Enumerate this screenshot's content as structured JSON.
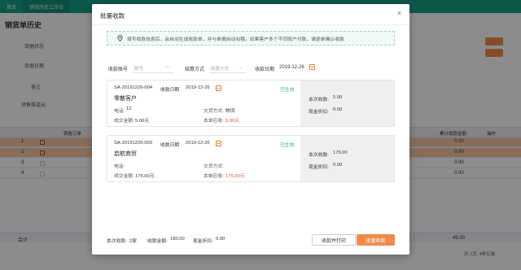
{
  "app": {
    "tabs": [
      "首页",
      "销货历史工作台"
    ],
    "page_title": "销货单历史",
    "form_labels": [
      "单据状态",
      "单据日期",
      "备注",
      "销售渠道出"
    ],
    "grid_headers": [
      "销售订单",
      "累计收款金额",
      "操作"
    ],
    "grid_rows": [
      {
        "no": "1",
        "amount": "0.00"
      },
      {
        "no": "2",
        "amount": "0.00"
      },
      {
        "no": "3",
        "amount": "0.00"
      },
      {
        "no": "4",
        "amount": "0.00"
      }
    ],
    "footer_label": "合计",
    "footer_total": "45.00",
    "pager_text": "共 1页, 4条记录"
  },
  "modal": {
    "title": "批量收款",
    "close": "×",
    "notice": "填写收款信息后，会自动生成收款单，并与单据自动勾稽。如果客户多个不同账户付款，请逐单确认收款",
    "filters": {
      "account_label": "收款账号",
      "account_placeholder": "账号",
      "method_label": "结算方式",
      "method_placeholder": "结算方式",
      "date_label": "收款日期",
      "date_value": "2019-12-26"
    },
    "cards": [
      {
        "order_no": "SA-20191226-004",
        "date_label": "收款日期",
        "date_value": "2019-12-26",
        "status": "已生效",
        "customer": "零散客户",
        "phone_label": "电话:",
        "phone": "12",
        "deal_amount_label": "成交金额:",
        "deal_amount": "5.00元",
        "trade_method_label": "交货方式:",
        "trade_method": "物流",
        "due_label": "本单应收:",
        "due": "5.00元",
        "this_receive_label": "本次收款:",
        "this_receive": "5.00",
        "discount_label": "现金折扣:",
        "discount": "0.00"
      },
      {
        "order_no": "SA-20191226-003",
        "date_label": "收款日期",
        "date_value": "2019-12-26",
        "status": "已生效",
        "customer": "启航商贸",
        "phone_label": "电话:",
        "phone": "",
        "deal_amount_label": "成交金额:",
        "deal_amount": "175.00元",
        "trade_method_label": "交货方式:",
        "trade_method": "",
        "due_label": "本单应收:",
        "due": "175.00元",
        "this_receive_label": "本次收款:",
        "this_receive": "175.00",
        "discount_label": "现金折扣:",
        "discount": "0.00"
      }
    ],
    "summary": {
      "count_label": "本次收款:",
      "count": "2家",
      "amount_label": "收款金额:",
      "amount": "180.00",
      "discount_label": "现金折扣:",
      "discount": "0.00"
    },
    "buttons": {
      "print": "收款并打印",
      "batch": "批量收款"
    },
    "colors": {
      "accent": "#f08a4b",
      "red": "#e74c3c",
      "green": "#27ae60",
      "notice_bg": "#effaf5"
    }
  }
}
